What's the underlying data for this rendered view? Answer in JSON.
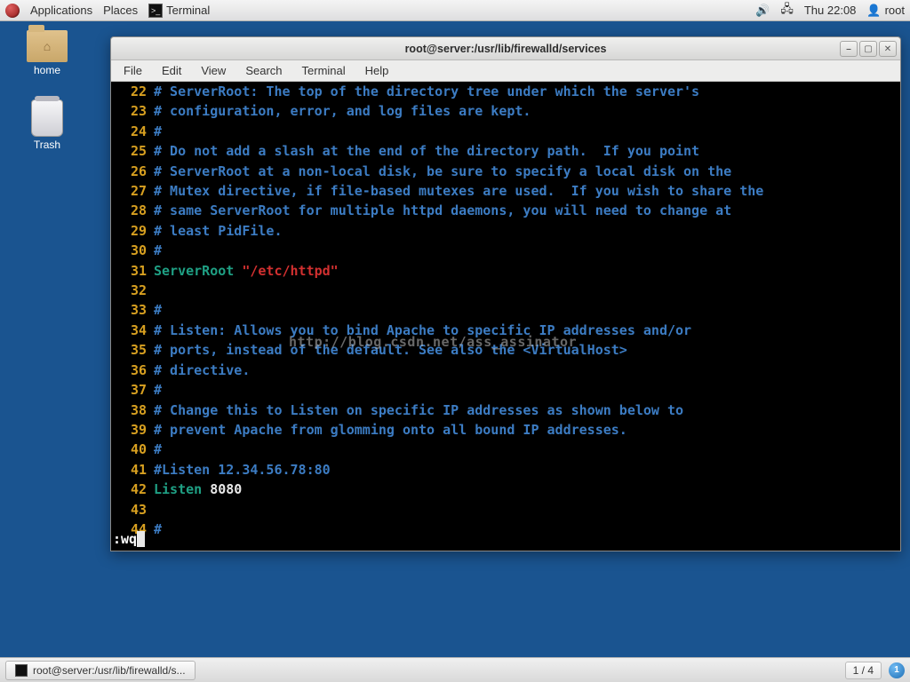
{
  "top_panel": {
    "applications": "Applications",
    "places": "Places",
    "task_app": "Terminal",
    "clock": "Thu 22:08",
    "user": "root"
  },
  "desktop": {
    "home_label": "home",
    "trash_label": "Trash"
  },
  "window": {
    "title": "root@server:/usr/lib/firewalld/services",
    "menu": {
      "file": "File",
      "edit": "Edit",
      "view": "View",
      "search": "Search",
      "terminal": "Terminal",
      "help": "Help"
    },
    "controls": {
      "min": "–",
      "max": "▢",
      "close": "✕"
    }
  },
  "editor": {
    "lines": [
      {
        "n": "22",
        "segs": [
          {
            "c": "cm",
            "t": "# ServerRoot: The top of the directory tree under which the server's"
          }
        ]
      },
      {
        "n": "23",
        "segs": [
          {
            "c": "cm",
            "t": "# configuration, error, and log files are kept."
          }
        ]
      },
      {
        "n": "24",
        "segs": [
          {
            "c": "cm",
            "t": "#"
          }
        ]
      },
      {
        "n": "25",
        "segs": [
          {
            "c": "cm",
            "t": "# Do not add a slash at the end of the directory path.  If you point"
          }
        ]
      },
      {
        "n": "26",
        "segs": [
          {
            "c": "cm",
            "t": "# ServerRoot at a non-local disk, be sure to specify a local disk on the"
          }
        ]
      },
      {
        "n": "27",
        "segs": [
          {
            "c": "cm",
            "t": "# Mutex directive, if file-based mutexes are used.  If you wish to share the"
          }
        ]
      },
      {
        "n": "28",
        "segs": [
          {
            "c": "cm",
            "t": "# same ServerRoot for multiple httpd daemons, you will need to change at"
          }
        ]
      },
      {
        "n": "29",
        "segs": [
          {
            "c": "cm",
            "t": "# least PidFile."
          }
        ]
      },
      {
        "n": "30",
        "segs": [
          {
            "c": "cm",
            "t": "#"
          }
        ]
      },
      {
        "n": "31",
        "segs": [
          {
            "c": "kw",
            "t": "ServerRoot "
          },
          {
            "c": "str",
            "t": "\"/etc/httpd\""
          }
        ]
      },
      {
        "n": "32",
        "segs": []
      },
      {
        "n": "33",
        "segs": [
          {
            "c": "cm",
            "t": "#"
          }
        ]
      },
      {
        "n": "34",
        "segs": [
          {
            "c": "cm",
            "t": "# Listen: Allows you to bind Apache to specific IP addresses and/or"
          }
        ]
      },
      {
        "n": "35",
        "segs": [
          {
            "c": "cm",
            "t": "# ports, instead of the default. See also the <VirtualHost>"
          }
        ]
      },
      {
        "n": "36",
        "segs": [
          {
            "c": "cm",
            "t": "# directive."
          }
        ]
      },
      {
        "n": "37",
        "segs": [
          {
            "c": "cm",
            "t": "#"
          }
        ]
      },
      {
        "n": "38",
        "segs": [
          {
            "c": "cm",
            "t": "# Change this to Listen on specific IP addresses as shown below to"
          }
        ]
      },
      {
        "n": "39",
        "segs": [
          {
            "c": "cm",
            "t": "# prevent Apache from glomming onto all bound IP addresses."
          }
        ]
      },
      {
        "n": "40",
        "segs": [
          {
            "c": "cm",
            "t": "#"
          }
        ]
      },
      {
        "n": "41",
        "segs": [
          {
            "c": "cm",
            "t": "#Listen 12.34.56.78:80"
          }
        ]
      },
      {
        "n": "42",
        "segs": [
          {
            "c": "kw",
            "t": "Listen "
          },
          {
            "c": "pl",
            "t": "8080"
          }
        ]
      },
      {
        "n": "43",
        "segs": []
      },
      {
        "n": "44",
        "segs": [
          {
            "c": "cm",
            "t": "#"
          }
        ]
      }
    ],
    "command": ":wq",
    "watermark": "http://blog.csdn.net/ass_assinator"
  },
  "bottom_panel": {
    "task_label": "root@server:/usr/lib/firewalld/s...",
    "workspace": "1 / 4",
    "orb": "1"
  }
}
